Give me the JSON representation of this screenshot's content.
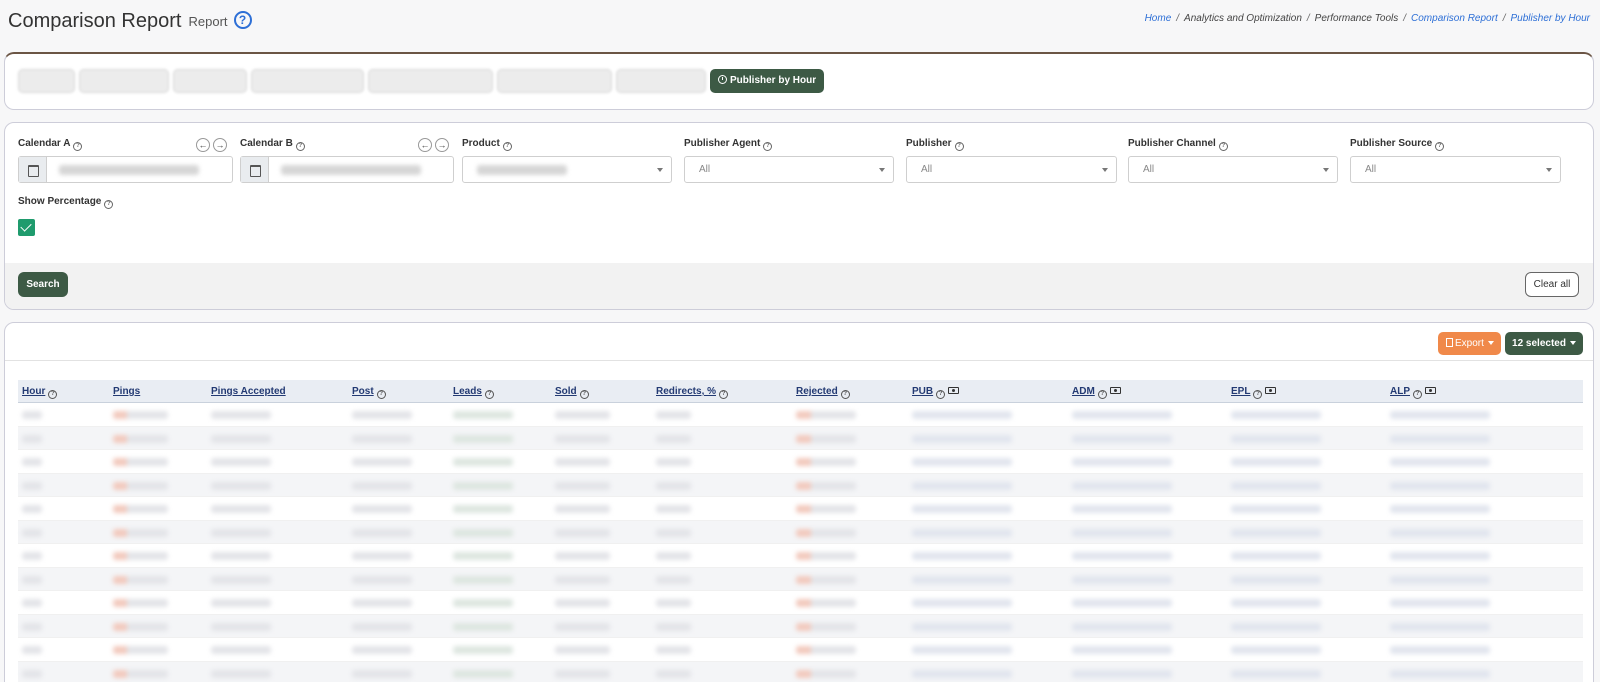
{
  "header": {
    "title": "Comparison Report",
    "subtitle": "Report",
    "help_symbol": "?"
  },
  "breadcrumb": [
    {
      "label": "Home",
      "link": true
    },
    {
      "label": "Analytics and Optimization",
      "link": false
    },
    {
      "label": "Performance Tools",
      "link": false
    },
    {
      "label": "Comparison Report",
      "link": true
    },
    {
      "label": "Publisher by Hour",
      "link": true
    }
  ],
  "breadcrumb_separator": "/",
  "tabs": {
    "active_label": "Publisher by Hour"
  },
  "filters": {
    "calendar_a": {
      "label": "Calendar A",
      "prev_symbol": "←",
      "next_symbol": "→"
    },
    "calendar_b": {
      "label": "Calendar B",
      "prev_symbol": "←",
      "next_symbol": "→"
    },
    "product": {
      "label": "Product"
    },
    "publisher_agent": {
      "label": "Publisher Agent",
      "value": "All"
    },
    "publisher": {
      "label": "Publisher",
      "value": "All"
    },
    "publisher_channel": {
      "label": "Publisher Channel",
      "value": "All"
    },
    "publisher_source": {
      "label": "Publisher Source",
      "value": "All"
    },
    "show_percentage": {
      "label": "Show Percentage",
      "checked": true
    },
    "help_symbol": "?"
  },
  "actions": {
    "search_label": "Search",
    "clear_label": "Clear all",
    "export_label": "Export",
    "columns_label": "12 selected"
  },
  "table": {
    "columns": [
      {
        "label": "Hour",
        "help": true,
        "money": false
      },
      {
        "label": "Pings",
        "help": false,
        "money": false
      },
      {
        "label": "Pings Accepted",
        "help": false,
        "money": false
      },
      {
        "label": "Post",
        "help": true,
        "money": false
      },
      {
        "label": "Leads",
        "help": true,
        "money": false
      },
      {
        "label": "Sold",
        "help": true,
        "money": false
      },
      {
        "label": "Redirects, %",
        "help": true,
        "money": false
      },
      {
        "label": "Rejected",
        "help": true,
        "money": false
      },
      {
        "label": "PUB",
        "help": true,
        "money": true
      },
      {
        "label": "ADM",
        "help": true,
        "money": true
      },
      {
        "label": "EPL",
        "help": true,
        "money": true
      },
      {
        "label": "ALP",
        "help": true,
        "money": true
      }
    ],
    "row_count": 12
  },
  "colors": {
    "primary_dark_green": "#3d5a45",
    "checkbox_green": "#1f9b6d",
    "export_orange": "#f0894a",
    "link_blue": "#2d6fd6",
    "header_text_navy": "#233a73"
  }
}
